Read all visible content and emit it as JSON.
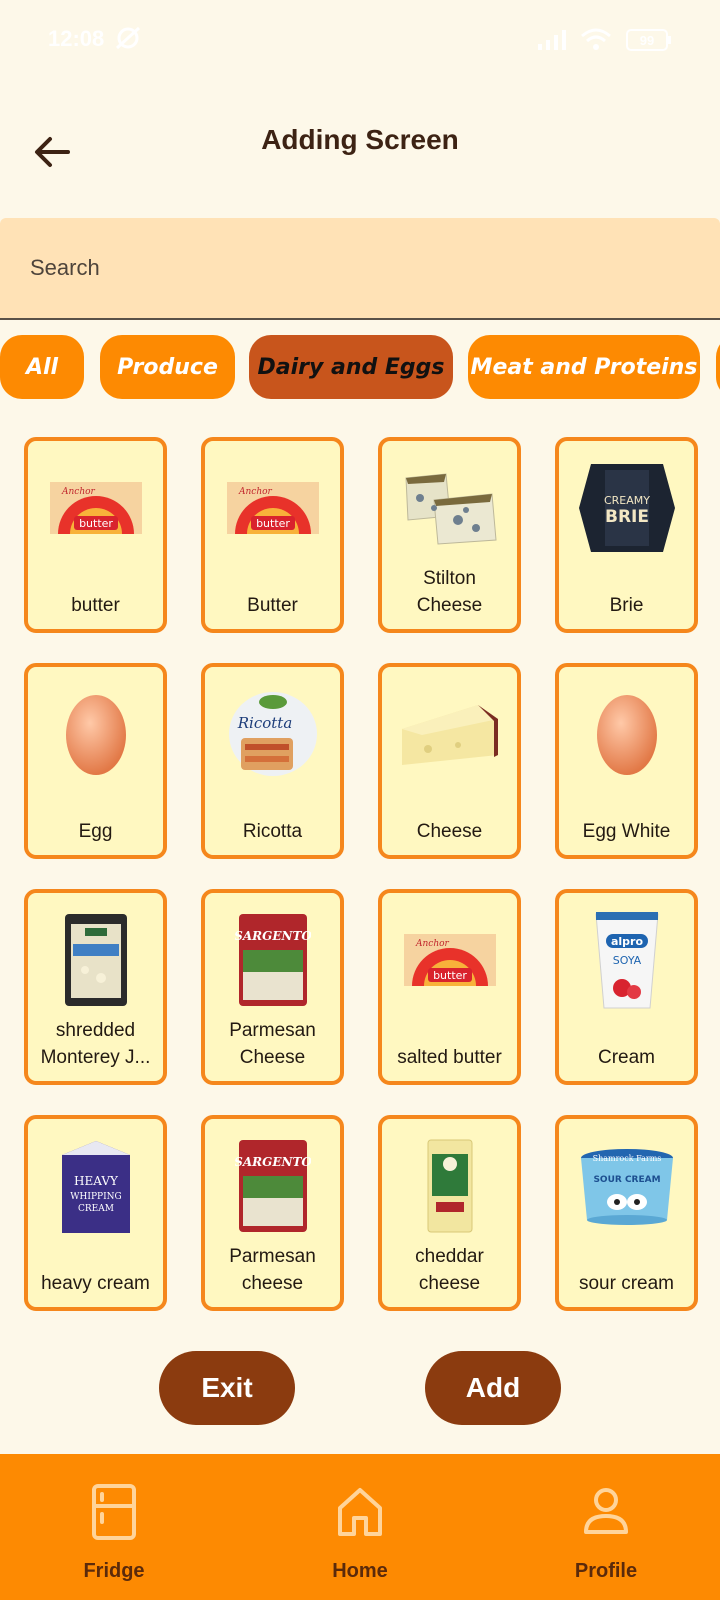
{
  "status_bar": {
    "time": "12:08",
    "battery": "99"
  },
  "header": {
    "title": "Adding Screen"
  },
  "search": {
    "placeholder": "Search"
  },
  "categories": [
    {
      "label": "All",
      "active": false
    },
    {
      "label": "Produce",
      "active": false
    },
    {
      "label": "Dairy and Eggs",
      "active": true
    },
    {
      "label": "Meat and Proteins",
      "active": false
    }
  ],
  "items": [
    {
      "line1": "butter",
      "line2": "",
      "image": "butter-package"
    },
    {
      "line1": "Butter",
      "line2": "",
      "image": "butter-package"
    },
    {
      "line1": "Stilton",
      "line2": "Cheese",
      "image": "blue-cheese"
    },
    {
      "line1": "Brie",
      "line2": "",
      "image": "brie-box"
    },
    {
      "line1": "Egg",
      "line2": "",
      "image": "egg"
    },
    {
      "line1": "Ricotta",
      "line2": "",
      "image": "ricotta-tub"
    },
    {
      "line1": "Cheese",
      "line2": "",
      "image": "cheese-wedge"
    },
    {
      "line1": "Egg White",
      "line2": "",
      "image": "egg"
    },
    {
      "line1": "shredded",
      "line2": "Monterey J...",
      "image": "shredded-cheese-bag"
    },
    {
      "line1": "Parmesan",
      "line2": "Cheese",
      "image": "parmesan-bag"
    },
    {
      "line1": "salted butter",
      "line2": "",
      "image": "butter-package"
    },
    {
      "line1": "Cream",
      "line2": "",
      "image": "yogurt-cup"
    },
    {
      "line1": "heavy cream",
      "line2": "",
      "image": "cream-carton"
    },
    {
      "line1": "Parmesan",
      "line2": "cheese",
      "image": "parmesan-bag"
    },
    {
      "line1": "cheddar",
      "line2": "cheese",
      "image": "cheddar-block"
    },
    {
      "line1": "sour cream",
      "line2": "",
      "image": "sour-cream-tub"
    }
  ],
  "image_text": {
    "butter_brand": "Anchor",
    "butter_word": "butter",
    "brie_line1": "CREAMY",
    "brie_line2": "BRIE",
    "ricotta_word": "Ricotta",
    "parmesan_brand": "SARGENTO",
    "yogurt_brand": "alpro",
    "yogurt_word": "SOYA",
    "cream_line1": "HEAVY",
    "cream_line2": "WHIPPING",
    "cream_line3": "CREAM",
    "sour_cream_brand": "Shamrock Farms",
    "sour_cream_word": "SOUR CREAM"
  },
  "actions": {
    "exit_label": "Exit",
    "add_label": "Add"
  },
  "nav": [
    {
      "label": "Fridge",
      "icon": "fridge-icon"
    },
    {
      "label": "Home",
      "icon": "home-icon"
    },
    {
      "label": "Profile",
      "icon": "profile-icon"
    }
  ],
  "colors": {
    "background": "#fdf8e9",
    "accent": "#fd8a02",
    "chip_active": "#c8551c",
    "card_bg": "#fff8c1",
    "card_border": "#f5871c",
    "button": "#8b3b0f",
    "search_bg": "#ffe2b6"
  }
}
